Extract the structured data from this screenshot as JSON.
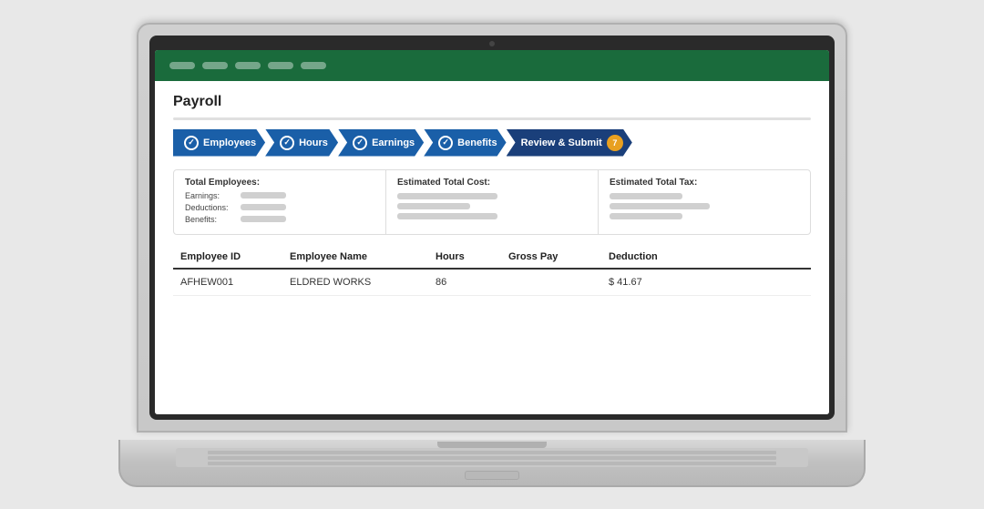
{
  "page": {
    "title": "Payroll"
  },
  "topbar": {
    "dots": [
      "dot1",
      "dot2",
      "dot3",
      "dot4",
      "dot5",
      "dot6"
    ]
  },
  "steps": [
    {
      "id": "employees",
      "label": "Employees",
      "checked": true
    },
    {
      "id": "hours",
      "label": "Hours",
      "checked": true
    },
    {
      "id": "earnings",
      "label": "Earnings",
      "checked": true
    },
    {
      "id": "benefits",
      "label": "Benefits",
      "checked": true
    },
    {
      "id": "review",
      "label": "Review & Submit",
      "badge": "7"
    }
  ],
  "summary": {
    "col1": {
      "title": "Total Employees:",
      "rows": [
        {
          "label": "Earnings:"
        },
        {
          "label": "Deductions:"
        },
        {
          "label": "Benefits:"
        }
      ]
    },
    "col2": {
      "title": "Estimated Total Cost:"
    },
    "col3": {
      "title": "Estimated Total Tax:"
    }
  },
  "table": {
    "headers": [
      "Employee ID",
      "Employee Name",
      "Hours",
      "Gross Pay",
      "Deduction"
    ],
    "rows": [
      {
        "employee_id": "AFHEW001",
        "employee_name": "ELDRED WORKS",
        "hours": "86",
        "gross_pay": "",
        "deduction": "$ 41.67"
      }
    ]
  }
}
